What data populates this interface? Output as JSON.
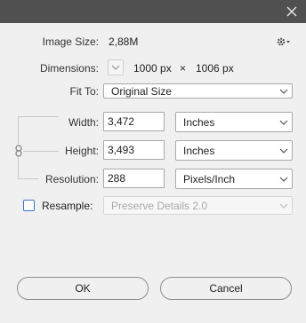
{
  "image_size": {
    "label": "Image Size:",
    "value": "2,88M"
  },
  "dimensions": {
    "label": "Dimensions:",
    "width": "1000 px",
    "times": "×",
    "height": "1006 px"
  },
  "fit_to": {
    "label": "Fit To:",
    "value": "Original Size"
  },
  "width": {
    "label": "Width:",
    "value": "3,472",
    "unit": "Inches"
  },
  "height": {
    "label": "Height:",
    "value": "3,493",
    "unit": "Inches"
  },
  "resolution": {
    "label": "Resolution:",
    "value": "288",
    "unit": "Pixels/Inch"
  },
  "resample": {
    "label": "Resample:",
    "checked": false,
    "method": "Preserve Details 2.0"
  },
  "buttons": {
    "ok": "OK",
    "cancel": "Cancel"
  },
  "colors": {
    "titlebar": "#505050",
    "background": "#f0f0f0",
    "checkbox_accent": "#3b74c9"
  },
  "icons": {
    "close": "close-icon",
    "settings": "gear-icon",
    "link": "link-icon"
  }
}
